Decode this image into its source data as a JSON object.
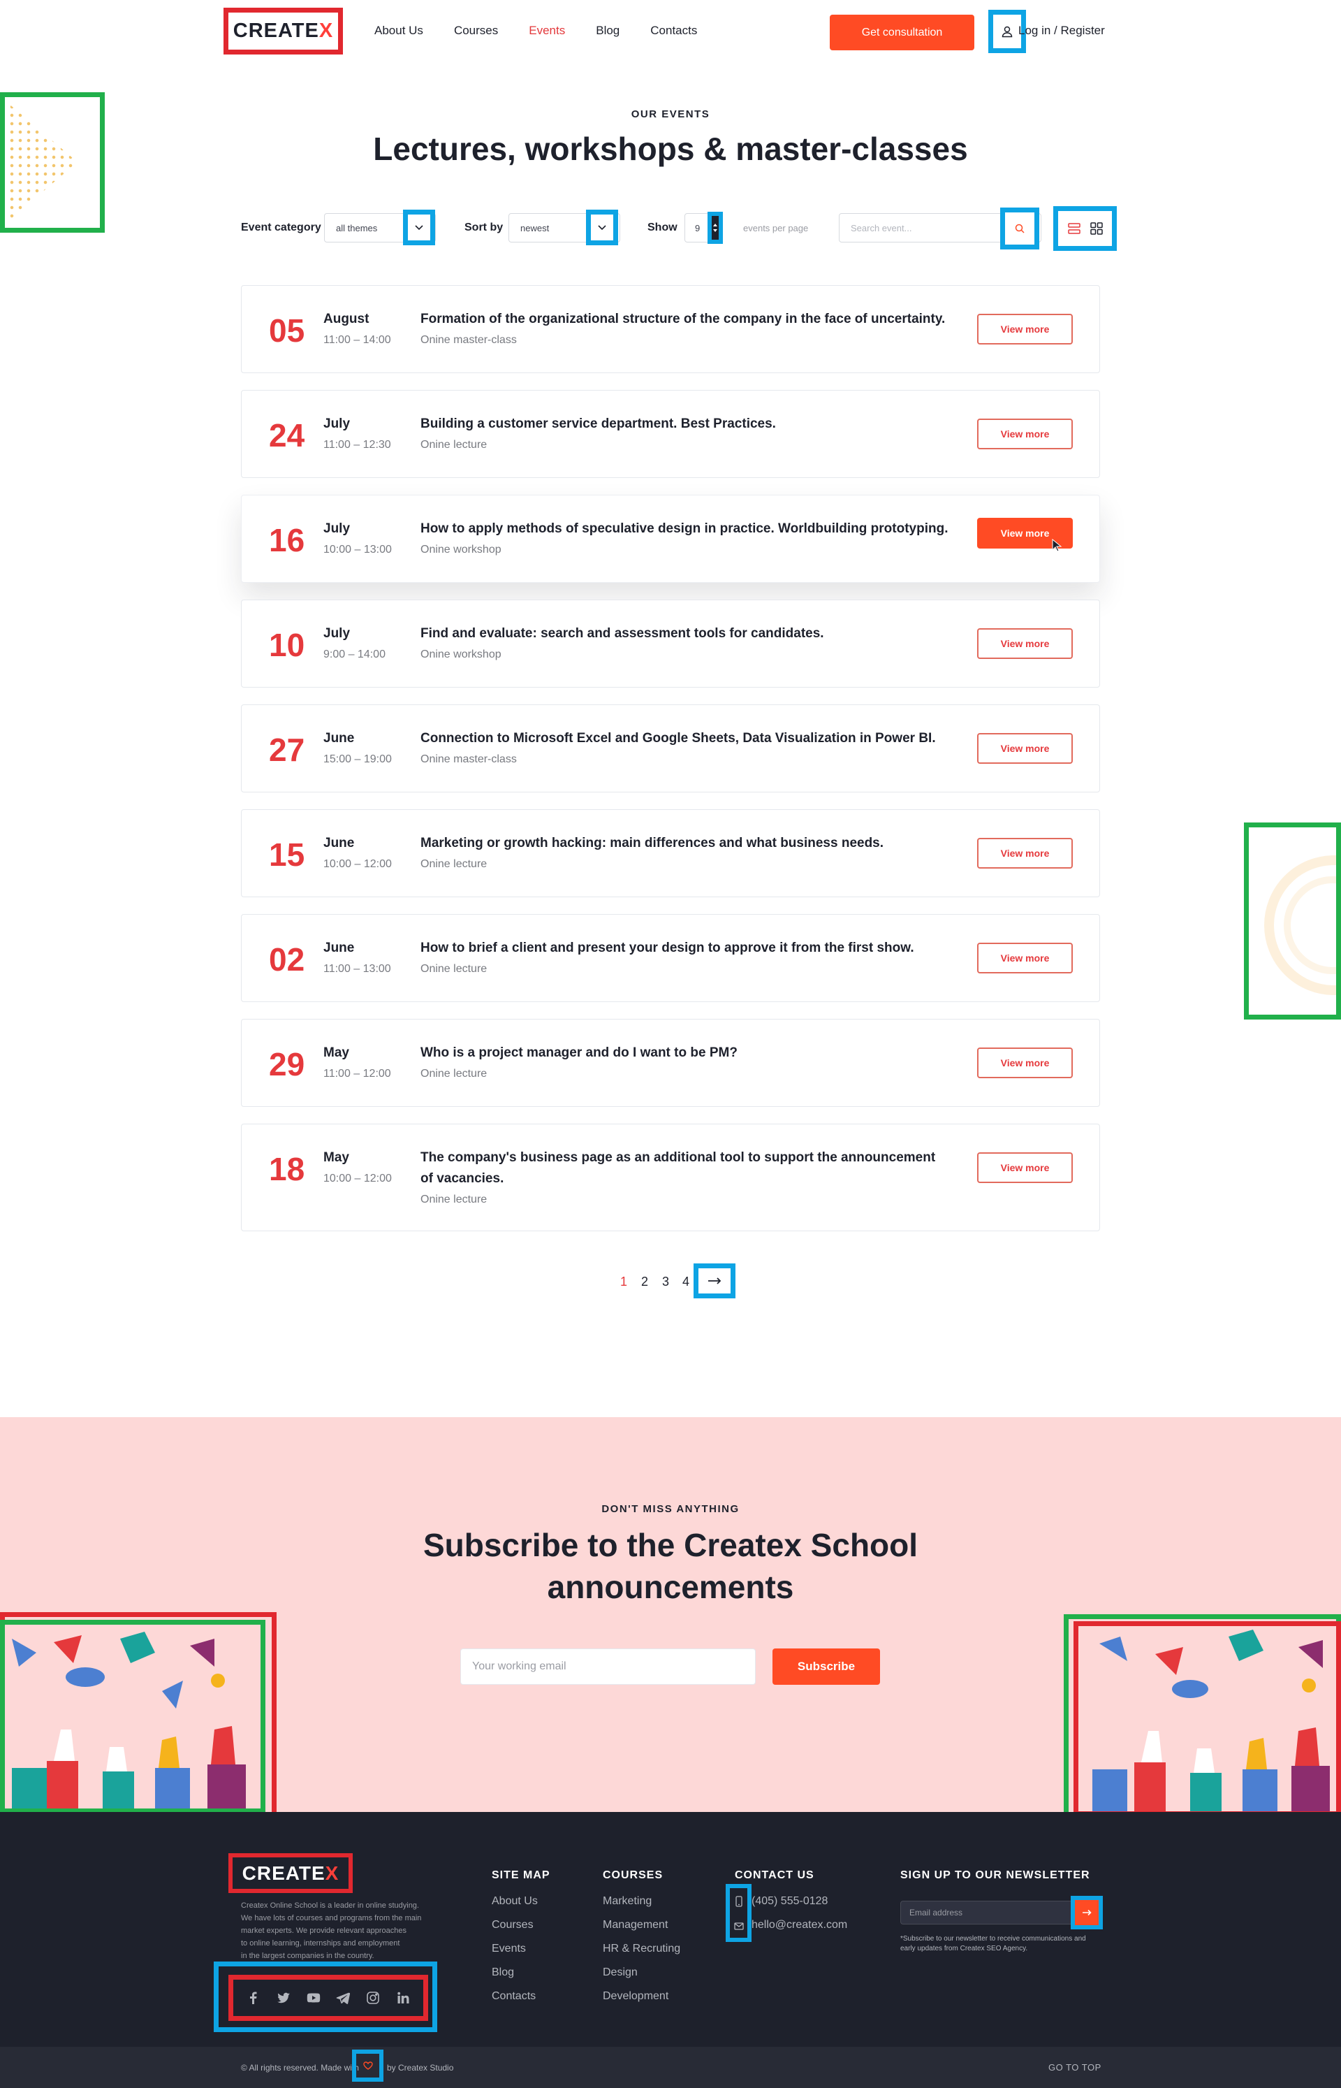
{
  "header": {
    "logo_main": "CREATE",
    "logo_x": "X",
    "nav": [
      {
        "label": "About Us",
        "active": false
      },
      {
        "label": "Courses",
        "active": false
      },
      {
        "label": "Events",
        "active": true
      },
      {
        "label": "Blog",
        "active": false
      },
      {
        "label": "Contacts",
        "active": false
      }
    ],
    "cta_label": "Get consultation",
    "login_label": "Log in / Register"
  },
  "hero": {
    "eyebrow": "OUR EVENTS",
    "title": "Lectures, workshops & master-classes"
  },
  "filters": {
    "category_label": "Event category",
    "category_value": "all themes",
    "sort_label": "Sort by",
    "sort_value": "newest",
    "show_label": "Show",
    "show_value": "9",
    "per_page_label": "events per page",
    "search_placeholder": "Search event..."
  },
  "events": [
    {
      "day": "05",
      "month": "August",
      "time": "11:00 – 14:00",
      "title": "Formation of the organizational structure of the company in the face of uncertainty.",
      "type": "Onine master-class",
      "button": "View more",
      "highlight": false
    },
    {
      "day": "24",
      "month": "July",
      "time": "11:00 – 12:30",
      "title": "Building a customer service department. Best Practices.",
      "type": "Onine lecture",
      "button": "View more",
      "highlight": false
    },
    {
      "day": "16",
      "month": "July",
      "time": "10:00 – 13:00",
      "title": "How to apply methods of speculative design in practice. Worldbuilding prototyping.",
      "type": "Onine workshop",
      "button": "View more",
      "highlight": true
    },
    {
      "day": "10",
      "month": "July",
      "time": "9:00 – 14:00",
      "title": "Find and evaluate: search and assessment tools for candidates.",
      "type": "Onine workshop",
      "button": "View more",
      "highlight": false
    },
    {
      "day": "27",
      "month": "June",
      "time": "15:00 – 19:00",
      "title": "Connection to Microsoft Excel and Google Sheets, Data Visualization in Power BI.",
      "type": "Onine master-class",
      "button": "View more",
      "highlight": false
    },
    {
      "day": "15",
      "month": "June",
      "time": "10:00 – 12:00",
      "title": "Marketing or growth hacking: main differences and what business needs.",
      "type": "Onine lecture",
      "button": "View more",
      "highlight": false
    },
    {
      "day": "02",
      "month": "June",
      "time": "11:00 – 13:00",
      "title": "How to brief a client and present your design to approve it from the first show.",
      "type": "Onine lecture",
      "button": "View more",
      "highlight": false
    },
    {
      "day": "29",
      "month": "May",
      "time": "11:00 – 12:00",
      "title": "Who is a project manager and do I want to be PM?",
      "type": "Onine lecture",
      "button": "View more",
      "highlight": false
    },
    {
      "day": "18",
      "month": "May",
      "time": "10:00 – 12:00",
      "title": "The company's business page as an additional tool to support the announcement of vacancies.",
      "type": "Onine lecture",
      "button": "View more",
      "highlight": false
    }
  ],
  "pagination": {
    "pages": [
      "1",
      "2",
      "3",
      "4"
    ],
    "current": "1"
  },
  "subscribe": {
    "eyebrow": "DON'T MISS ANYTHING",
    "title_line1": "Subscribe to the Createx School",
    "title_line2": "announcements",
    "placeholder": "Your working email",
    "button": "Subscribe"
  },
  "footer": {
    "about": [
      "Createx Online School is a leader in online studying.",
      "We have lots of courses and programs from the main",
      "market experts. We provide relevant approaches",
      "to online learning, internships and employment",
      "in the largest companies in the country."
    ],
    "sitemap_title": "SITE MAP",
    "sitemap": [
      "About Us",
      "Courses",
      "Events",
      "Blog",
      "Contacts"
    ],
    "courses_title": "COURSES",
    "courses": [
      "Marketing",
      "Management",
      "HR & Recruting",
      "Design",
      "Development"
    ],
    "contact_title": "CONTACT US",
    "phone": "(405) 555-0128",
    "email": "hello@createx.com",
    "newsletter_title": "SIGN UP TO OUR NEWSLETTER",
    "newsletter_placeholder": "Email address",
    "newsletter_note_1": "*Subscribe to our newsletter to receive communications and",
    "newsletter_note_2": "early updates from Createx SEO Agency.",
    "copyright_pre": "© All rights reserved. Made with",
    "copyright_post": "by Createx Studio",
    "go_top": "GO TO TOP"
  },
  "colors": {
    "accent": "#ff4b24",
    "date_red": "#e5393c",
    "dark": "#1e212c",
    "subscribe_bg": "#fdd8d7"
  }
}
